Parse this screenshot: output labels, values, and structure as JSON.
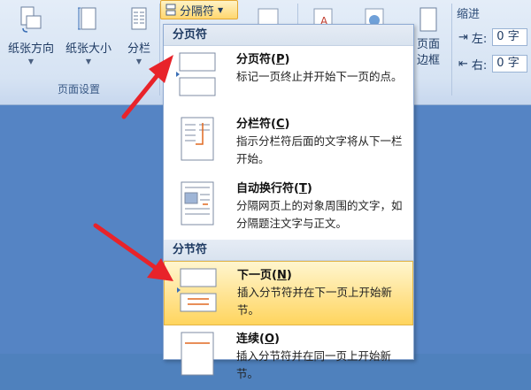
{
  "ribbon": {
    "buttons": {
      "orientation": "纸张方向",
      "size": "纸张大小",
      "columns": "分栏"
    },
    "group_label": "页面设置",
    "breaks_button": "分隔符",
    "partial_right": "页面\n边框",
    "indent": {
      "title": "缩进",
      "left_label": "左:",
      "left_value": "0 字",
      "right_label": "右:",
      "right_value": "0 字"
    }
  },
  "menu": {
    "page_breaks_header": "分页符",
    "section_breaks_header": "分节符",
    "items": [
      {
        "title": "分页符(P)",
        "key": "P",
        "desc": "标记一页终止并开始下一页的点。"
      },
      {
        "title": "分栏符(C)",
        "key": "C",
        "desc": "指示分栏符后面的文字将从下一栏开始。"
      },
      {
        "title": "自动换行符(T)",
        "key": "T",
        "desc": "分隔网页上的对象周围的文字，如分隔题注文字与正文。"
      },
      {
        "title": "下一页(N)",
        "key": "N",
        "desc": "插入分节符并在下一页上开始新节。",
        "highlighted": true
      },
      {
        "title": "连续(O)",
        "key": "O",
        "desc": "插入分节符并在同一页上开始新节。"
      }
    ]
  },
  "colors": {
    "arrow": "#e8232a",
    "highlight": "#ffe391",
    "document_bg": "#5584c4"
  }
}
